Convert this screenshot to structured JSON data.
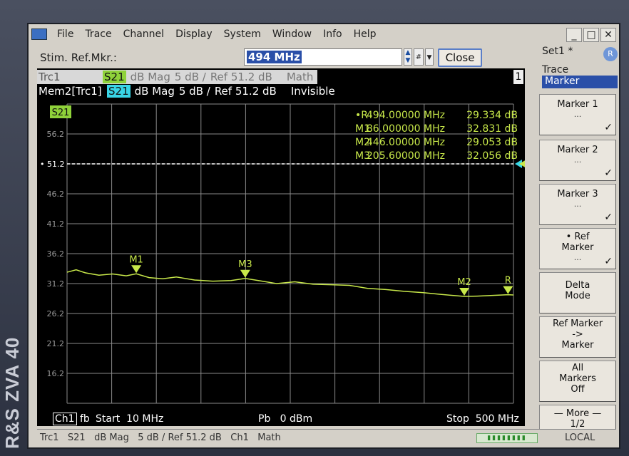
{
  "brand": "R&S ZVA 40",
  "menubar": {
    "items": [
      "File",
      "Trace",
      "Channel",
      "Display",
      "System",
      "Window",
      "Info",
      "Help"
    ],
    "window_controls": [
      "_",
      "□",
      "✕"
    ]
  },
  "toolbar": {
    "stim_label": "Stim. Ref.Mkr.:",
    "stim_value": "494 MHz",
    "close_label": "Close"
  },
  "setup": {
    "title": "Set1 *"
  },
  "trace_info": {
    "trc1": {
      "name": "Trc1",
      "param": "S21",
      "format": "dB Mag",
      "scale": "5 dB /",
      "ref": "Ref 51.2 dB",
      "extra": "Math"
    },
    "mem2": {
      "name": "Mem2[Trc1]",
      "param": "S21",
      "format": "dB Mag",
      "scale": "5 dB /",
      "ref": "Ref 51.2 dB",
      "extra": "Invisible"
    },
    "window_number": "1"
  },
  "markers_table": [
    {
      "name": "•R",
      "freq": "494.00000 MHz",
      "value": "29.334 dB"
    },
    {
      "name": "M1",
      "freq": "86.000000 MHz",
      "value": "32.831 dB"
    },
    {
      "name": "M2",
      "freq": "446.00000 MHz",
      "value": "29.053 dB"
    },
    {
      "name": "M3",
      "freq": "205.60000 MHz",
      "value": "32.056 dB"
    }
  ],
  "colors": {
    "trace": "#c8e84a",
    "mem_trace": "#39d5e6",
    "grid": "#8a8a8a",
    "ref_line": "#ffffff"
  },
  "chart_data": {
    "type": "line",
    "trace_badge": "S21",
    "x_range_mhz": [
      10,
      500
    ],
    "ylim": [
      11.2,
      61.2
    ],
    "y_ticks": [
      16.2,
      21.2,
      26.2,
      31.2,
      36.2,
      41.2,
      46.2,
      51.2,
      56.2
    ],
    "y_tick_labels": [
      "16.2",
      "21.2",
      "26.2",
      "31.2",
      "36.2",
      "41.2",
      "46.2",
      "51.2",
      "56.2"
    ],
    "ref_level": 51.2,
    "ref_label": "51.2",
    "grid": true,
    "series": [
      {
        "name": "Trc1",
        "x": [
          10,
          20,
          30,
          45,
          60,
          75,
          86,
          100,
          115,
          130,
          150,
          170,
          190,
          205.6,
          220,
          240,
          260,
          280,
          300,
          320,
          340,
          360,
          380,
          400,
          420,
          446,
          460,
          475,
          494,
          500
        ],
        "y": [
          33.1,
          33.5,
          33.0,
          32.6,
          32.8,
          32.5,
          32.831,
          32.2,
          32.0,
          32.3,
          31.8,
          31.6,
          31.7,
          32.056,
          31.7,
          31.2,
          31.5,
          31.1,
          31.0,
          30.9,
          30.4,
          30.2,
          29.9,
          29.7,
          29.4,
          29.053,
          29.1,
          29.2,
          29.334,
          29.3
        ]
      }
    ],
    "markers": [
      {
        "label": "M1",
        "x": 86,
        "y": 32.831
      },
      {
        "label": "M3",
        "x": 205.6,
        "y": 32.056
      },
      {
        "label": "M2",
        "x": 446,
        "y": 29.053
      },
      {
        "label": "R",
        "x": 494,
        "y": 29.334
      }
    ]
  },
  "bottom": {
    "channel": "Ch1",
    "fb": "fb",
    "start": "Start  10 MHz",
    "power": "Pb   0 dBm",
    "stop": "Stop  500 MHz"
  },
  "softkeys": {
    "header1": "Trace",
    "header2": "Marker",
    "keys": [
      {
        "label": "Marker 1",
        "sub": "...",
        "check": "✓"
      },
      {
        "label": "Marker 2",
        "sub": "...",
        "check": "✓"
      },
      {
        "label": "Marker 3",
        "sub": "...",
        "check": "✓"
      },
      {
        "label": "• Ref",
        "label2": "Marker",
        "sub": "...",
        "check": "✓"
      },
      {
        "label": "Delta",
        "label2": "Mode"
      },
      {
        "label": "Ref Marker",
        "label2": "->",
        "label3": "Marker"
      },
      {
        "label": "All",
        "label2": "Markers",
        "label3": "Off"
      },
      {
        "label": "— More —",
        "label2": "1/2"
      }
    ]
  },
  "statusbar": {
    "text": "Trc1   S21   dB Mag   5 dB / Ref 51.2 dB   Ch1   Math",
    "local": "LOCAL"
  }
}
